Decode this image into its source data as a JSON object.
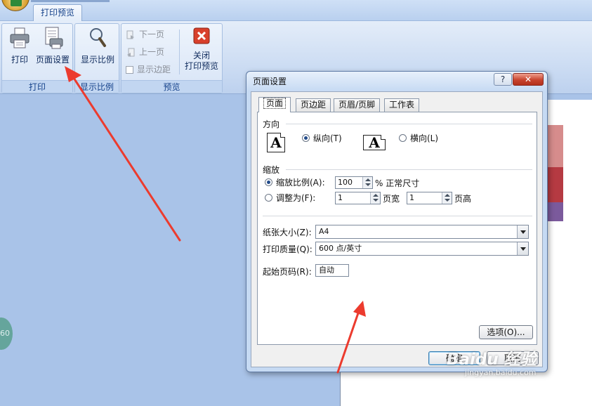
{
  "ribbon": {
    "active_tab": "打印预览",
    "groups": {
      "print": {
        "label": "打印",
        "print_button": "打印",
        "page_setup_button": "页面设置"
      },
      "zoom": {
        "label": "显示比例",
        "zoom_button": "显示比例"
      },
      "preview": {
        "label": "预览",
        "next_page": "下一页",
        "prev_page": "上一页",
        "show_margins": "显示边距",
        "close_button_line1": "关闭",
        "close_button_line2": "打印预览"
      }
    }
  },
  "workspace": {
    "badge": "60"
  },
  "dialog": {
    "title": "页面设置",
    "help": "?",
    "close": "✕",
    "tabs": [
      "页面",
      "页边距",
      "页眉/页脚",
      "工作表"
    ],
    "orientation": {
      "title": "方向",
      "portrait": "纵向(T)",
      "landscape": "横向(L)",
      "icon_letter": "A",
      "selected": "portrait"
    },
    "scaling": {
      "title": "缩放",
      "adjust_to": "缩放比例(A):",
      "adjust_value": "100",
      "adjust_suffix": "% 正常尺寸",
      "fit_to": "调整为(F):",
      "pages_wide_value": "1",
      "pages_wide_label": "页宽",
      "pages_tall_value": "1",
      "pages_tall_label": "页高",
      "selected": "adjust"
    },
    "paper_size": {
      "label": "纸张大小(Z):",
      "value": "A4"
    },
    "print_quality": {
      "label": "打印质量(Q):",
      "value": "600 点/英寸"
    },
    "first_page_number": {
      "label": "起始页码(R):",
      "value": "自动"
    },
    "options_button": "选项(O)...",
    "ok_button": "确定",
    "cancel_button": "取消"
  },
  "watermark": {
    "line1": "Baidu 经验",
    "line2": "jingyan.baidu.com"
  },
  "colors": {
    "annotation_arrow": "#ec3b2e",
    "workspace_bg": "#a9c3e8",
    "chart_bar_pink": "#d68c8c",
    "chart_bar_red": "#b53a42",
    "chart_bar_purple": "#7b5a9c"
  }
}
